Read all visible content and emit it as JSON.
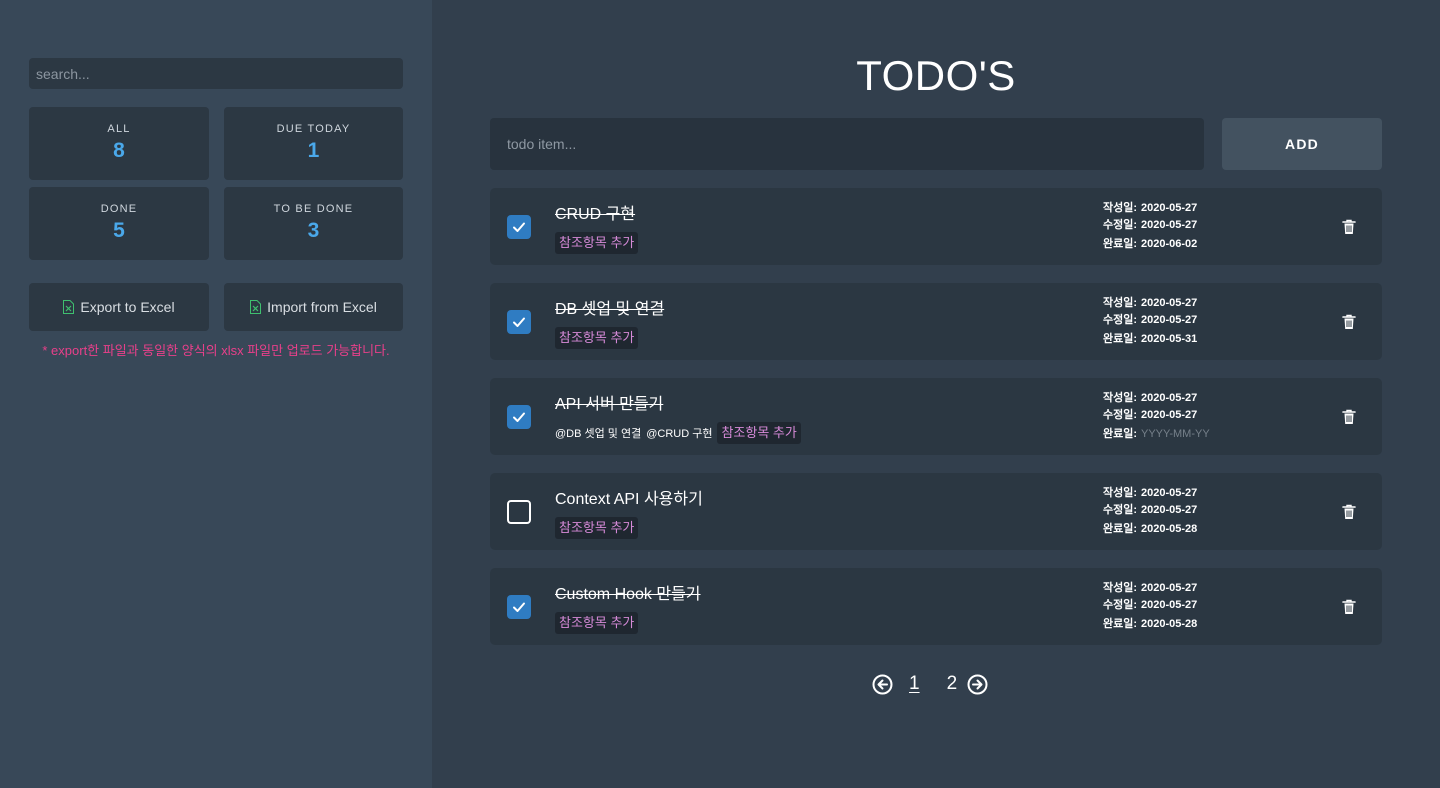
{
  "sidebar": {
    "search_placeholder": "search...",
    "stats": [
      {
        "label": "ALL",
        "value": "8"
      },
      {
        "label": "DUE TODAY",
        "value": "1"
      },
      {
        "label": "DONE",
        "value": "5"
      },
      {
        "label": "TO BE DONE",
        "value": "3"
      }
    ],
    "export_label": "Export to Excel",
    "import_label": "Import from Excel",
    "excel_note": "* export한 파일과 동일한 양식의 xlsx 파일만 업로드 가능합니다."
  },
  "main": {
    "title": "TODO'S",
    "input_placeholder": "todo item...",
    "add_label": "ADD",
    "created_label": "작성일:",
    "modified_label": "수정일:",
    "completed_label": "완료일:",
    "ref_add_label": "참조항목 추가",
    "todos": [
      {
        "title": "CRUD 구현",
        "done": true,
        "refs": [],
        "created": "2020-05-27",
        "modified": "2020-05-27",
        "completed": "2020-06-02"
      },
      {
        "title": "DB 셋업 및 연결",
        "done": true,
        "refs": [],
        "created": "2020-05-27",
        "modified": "2020-05-27",
        "completed": "2020-05-31"
      },
      {
        "title": "API 서버 만들기",
        "done": true,
        "refs": [
          "@DB 셋업 및 연결",
          "@CRUD 구현"
        ],
        "created": "2020-05-27",
        "modified": "2020-05-27",
        "completed": "YYYY-MM-YY"
      },
      {
        "title": "Context API 사용하기",
        "done": false,
        "refs": [],
        "created": "2020-05-27",
        "modified": "2020-05-27",
        "completed": "2020-05-28"
      },
      {
        "title": "Custom Hook 만들기",
        "done": true,
        "refs": [],
        "created": "2020-05-27",
        "modified": "2020-05-27",
        "completed": "2020-05-28"
      }
    ],
    "pagination": {
      "pages": [
        "1",
        "2"
      ],
      "current": "1"
    }
  },
  "colors": {
    "accent": "#4aa8ea",
    "checkbox": "#2f7cc2",
    "warning": "#e8408a",
    "ref_add": "#d68ad8",
    "excel_green": "#3fbf6f"
  }
}
